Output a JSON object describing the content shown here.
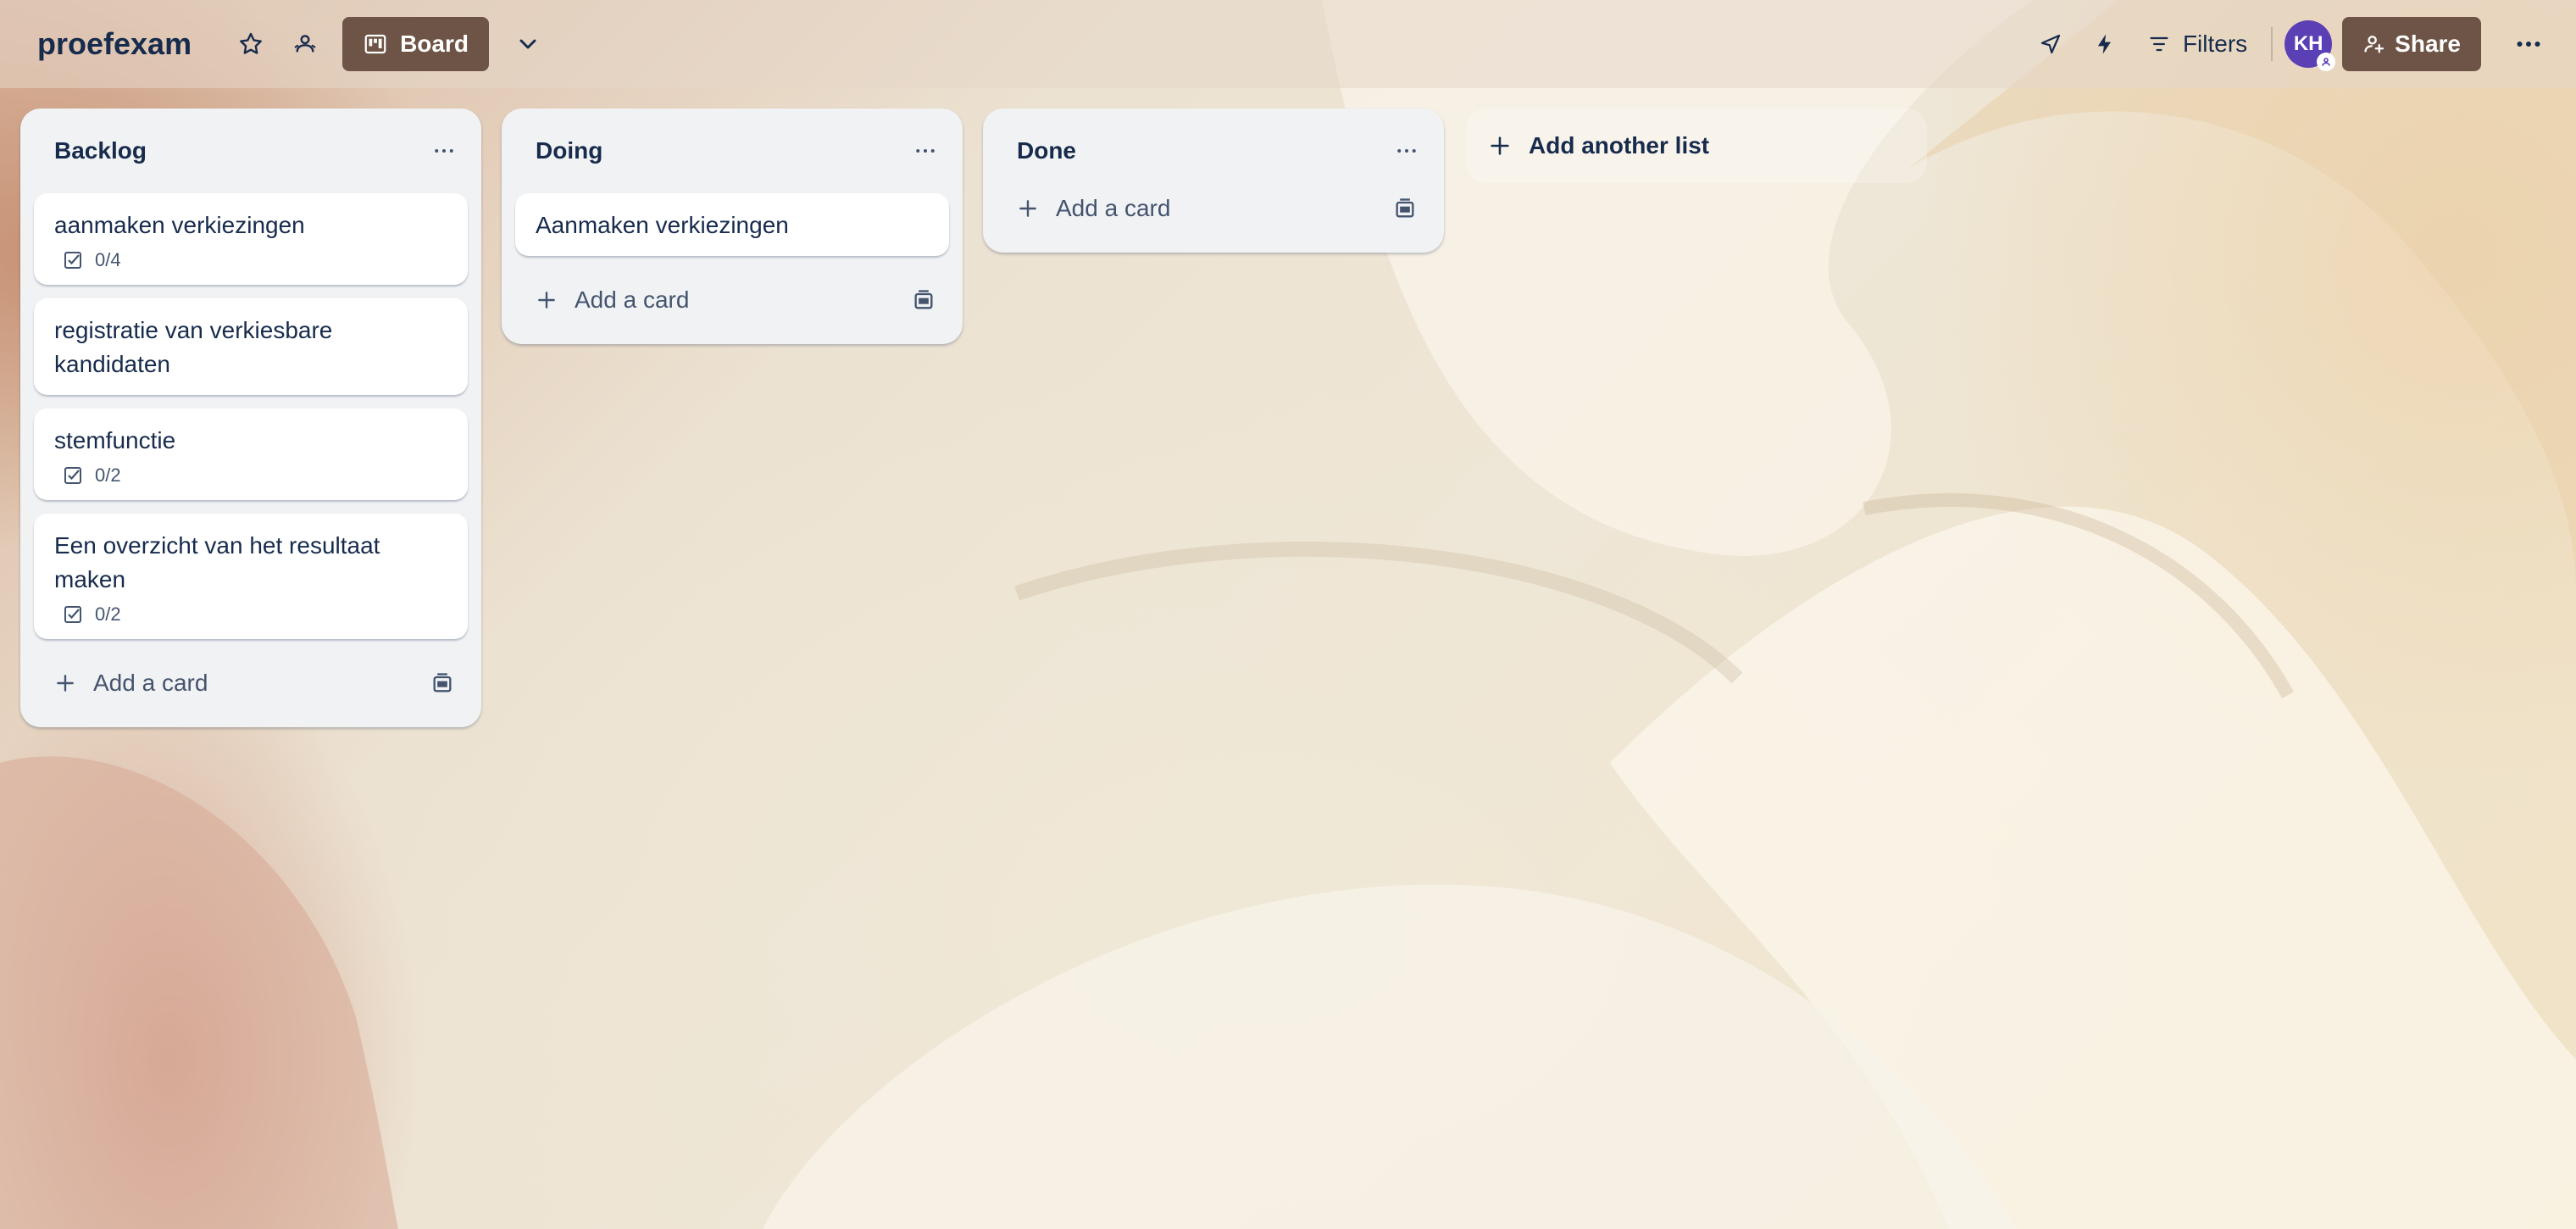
{
  "header": {
    "board_title": "proefexam",
    "view_label": "Board",
    "filters_label": "Filters",
    "avatar_initials": "KH",
    "share_label": "Share"
  },
  "lists": [
    {
      "title": "Backlog",
      "cards": [
        {
          "title": "aanmaken verkiezingen",
          "checklist": "0/4"
        },
        {
          "title": "registratie van verkiesbare kandidaten",
          "checklist": ""
        },
        {
          "title": "stemfunctie",
          "checklist": "0/2"
        },
        {
          "title": "Een overzicht van het resultaat maken",
          "checklist": "0/2"
        }
      ],
      "add_card_label": "Add a card"
    },
    {
      "title": "Doing",
      "cards": [
        {
          "title": "Aanmaken verkiezingen",
          "checklist": ""
        }
      ],
      "add_card_label": "Add a card"
    },
    {
      "title": "Done",
      "cards": [],
      "add_card_label": "Add a card"
    }
  ],
  "add_list_label": "Add another list",
  "colors": {
    "accent_button": "#6d5446",
    "avatar": "#5b3fb5",
    "list_bg": "#f1f2f4",
    "text_primary": "#172b4d",
    "text_secondary": "#44546f"
  },
  "icons": [
    "star-icon",
    "workspace-visibility-icon",
    "board-icon",
    "chevron-down-icon",
    "power-ups-icon",
    "automation-icon",
    "filter-icon",
    "share-user-icon",
    "more-icon",
    "list-menu-icon",
    "checklist-icon",
    "plus-icon",
    "card-template-icon"
  ]
}
